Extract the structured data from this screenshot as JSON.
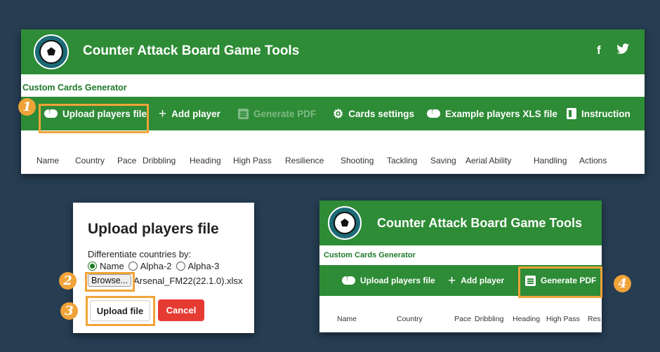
{
  "app": {
    "title": "Counter Attack Board Game Tools",
    "subtitle": "Custom Cards Generator",
    "social": {
      "facebook": "f",
      "twitter": "🐦"
    }
  },
  "toolbar": {
    "upload": "Upload players file",
    "add": "Add player",
    "generate": "Generate PDF",
    "settings": "Cards settings",
    "example": "Example players XLS file",
    "instruction": "Instruction"
  },
  "columns": [
    "Name",
    "Country",
    "Pace",
    "Dribbling",
    "Heading",
    "High Pass",
    "Resilience",
    "Shooting",
    "Tackling",
    "Saving",
    "Aerial Ability",
    "Handling",
    "Actions"
  ],
  "columns_small": [
    "Name",
    "Country",
    "Pace",
    "Dribbling",
    "Heading",
    "High Pass",
    "Res"
  ],
  "dialog": {
    "title": "Upload players file",
    "label": "Differentiate countries by:",
    "options": [
      "Name",
      "Alpha-2",
      "Alpha-3"
    ],
    "selected": "Name",
    "browse": "Browse...",
    "file": "Arsenal_FM22(22.1.0).xlsx",
    "upload": "Upload file",
    "cancel": "Cancel"
  },
  "steps": [
    "1",
    "2",
    "3",
    "4"
  ],
  "colors": {
    "green": "#2e8b36",
    "accent": "#f0a338",
    "cancel": "#e53b33",
    "background": "#263d52"
  }
}
